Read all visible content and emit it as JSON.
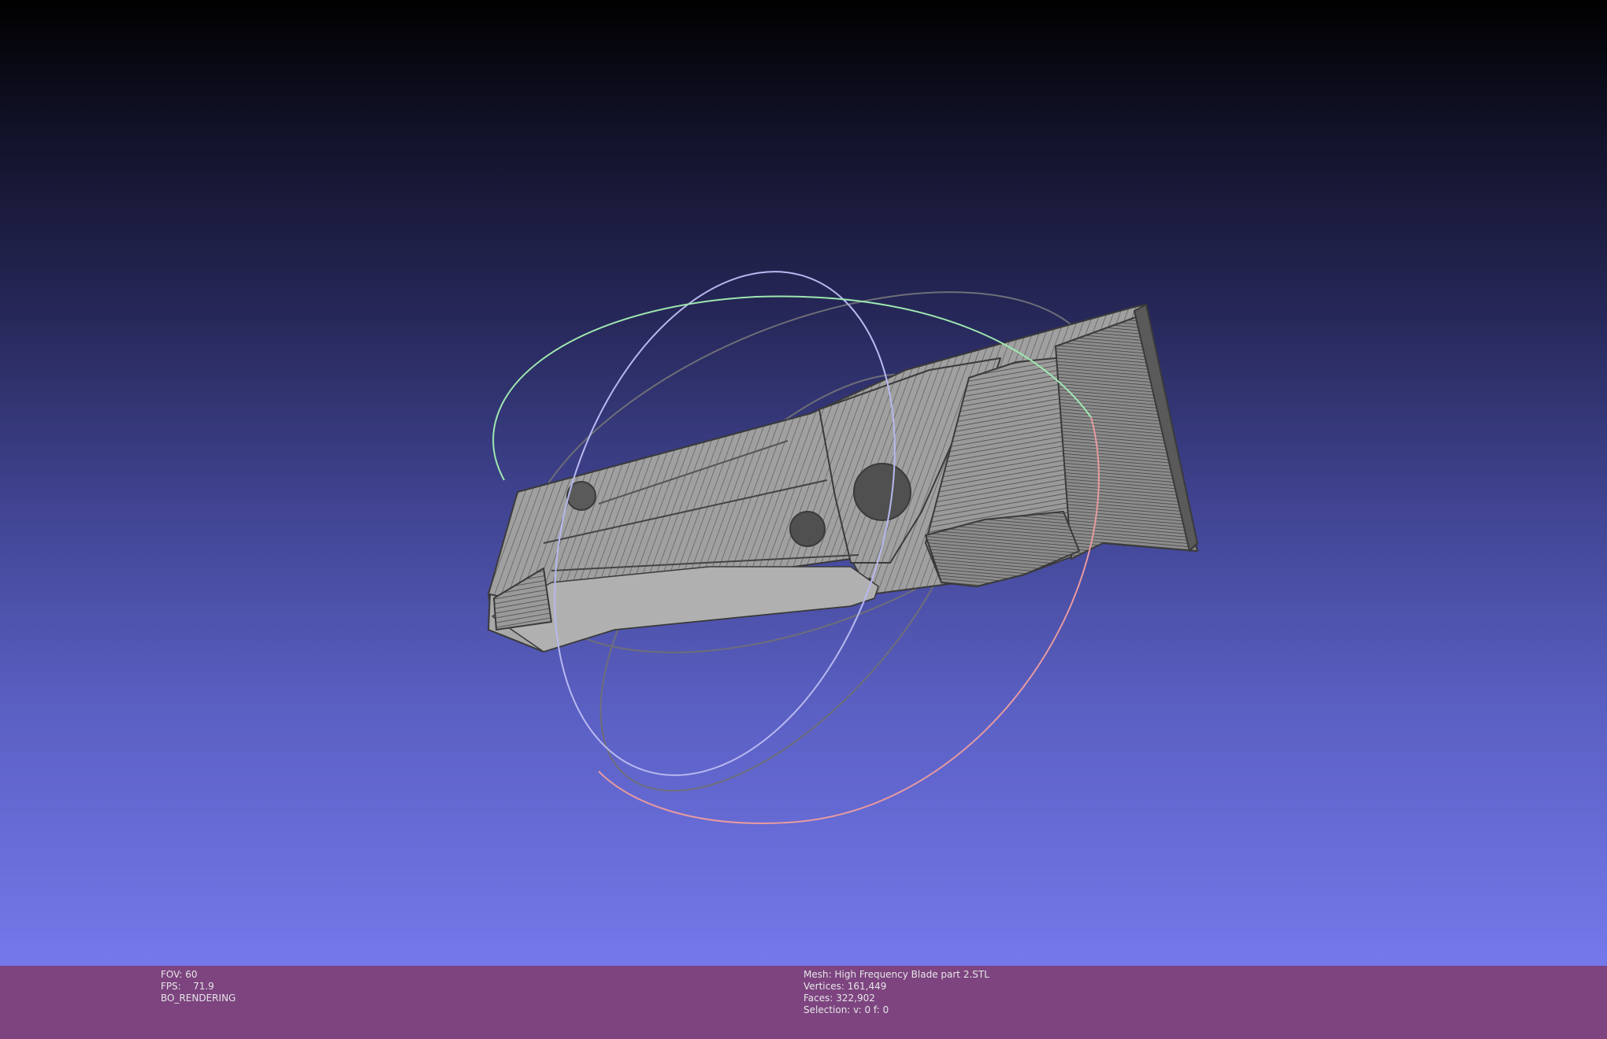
{
  "viewport": {
    "background_top": "#000000",
    "background_bottom": "#7478ea",
    "mesh_fill": "#a6a6a6",
    "mesh_edge": "#3c3c3c",
    "trackball": {
      "x_ring_color": "#e89aa0",
      "y_ring_color": "#9fe8b0",
      "z_ring_color": "#b8b8f0",
      "neutral_ring_color": "#6e6e78"
    }
  },
  "info_bar": {
    "background": "#7d4480",
    "left": {
      "fov_label": "FOV:",
      "fov_value": "60",
      "fps_label": "FPS:",
      "fps_value": "71.9",
      "render_mode": "BO_RENDERING"
    },
    "right": {
      "mesh_label": "Mesh:",
      "mesh_value": "High Frequency Blade part 2.STL",
      "vertices_label": "Vertices:",
      "vertices_value": "161,449",
      "faces_label": "Faces:",
      "faces_value": "322,902",
      "selection_label": "Selection:",
      "selection_value": "v: 0 f: 0"
    }
  }
}
